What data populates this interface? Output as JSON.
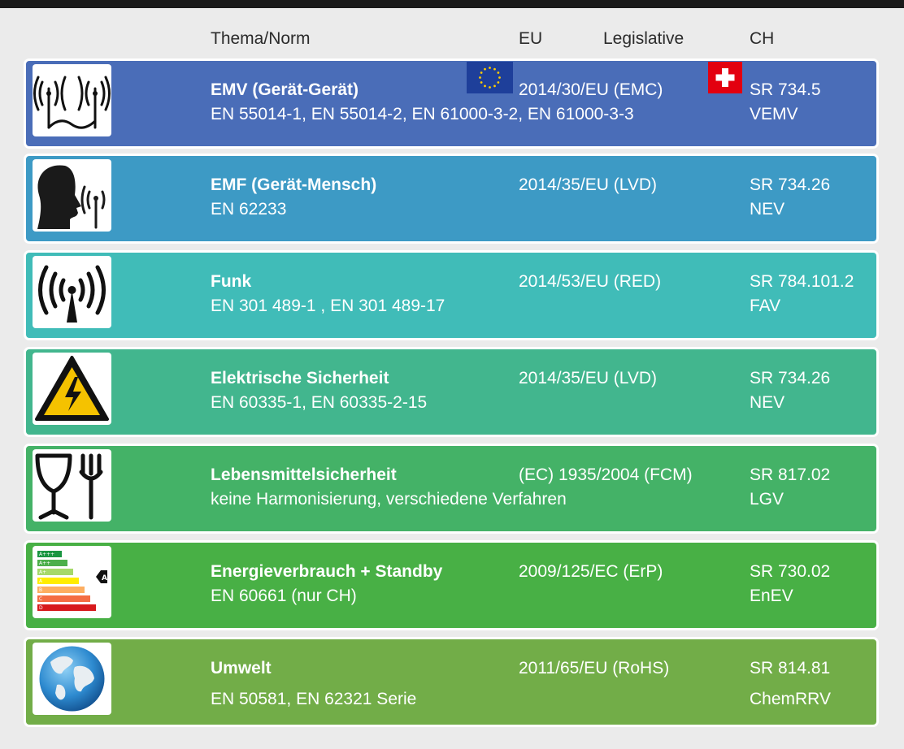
{
  "header": {
    "topic": "Thema/Norm",
    "eu": "EU",
    "legislative": "Legislative",
    "ch": "CH"
  },
  "flags": {
    "eu": "eu-flag-icon",
    "ch": "swiss-flag-icon"
  },
  "rows": [
    {
      "icon": "emc-device-icon",
      "color": "#4a6db8",
      "title": "EMV (Gerät-Gerät)",
      "norms": "EN 55014-1, EN 55014-2, EN 61000-3-2, EN 61000-3-3",
      "eu": "2014/30/EU (EMC)",
      "ch_code": "SR 734.5",
      "ch_abbr": "VEMV"
    },
    {
      "icon": "emf-person-icon",
      "color": "#3d9ac5",
      "title": "EMF (Gerät-Mensch)",
      "norms": "EN 62233",
      "eu": "2014/35/EU (LVD)",
      "ch_code": "SR 734.26",
      "ch_abbr": "NEV"
    },
    {
      "icon": "radio-antenna-icon",
      "color": "#40bcb8",
      "title": "Funk",
      "norms": "EN 301 489-1 , EN 301 489-17",
      "eu": "2014/53/EU (RED)",
      "ch_code": "SR 784.101.2",
      "ch_abbr": "FAV"
    },
    {
      "icon": "high-voltage-warning-icon",
      "color": "#42b68e",
      "title": "Elektrische Sicherheit",
      "norms": "EN 60335-1, EN 60335-2-15",
      "eu": "2014/35/EU (LVD)",
      "ch_code": "SR 734.26",
      "ch_abbr": "NEV"
    },
    {
      "icon": "food-safe-icon",
      "color": "#44b267",
      "title": "Lebensmittelsicherheit",
      "norms": "keine Harmonisierung, verschiedene Verfahren",
      "eu": "(EC) 1935/2004 (FCM)",
      "ch_code": "SR 817.02",
      "ch_abbr": "LGV"
    },
    {
      "icon": "energy-label-icon",
      "color": "#48b045",
      "title": "Energieverbrauch + Standby",
      "norms": "EN 60661 (nur CH)",
      "eu": "2009/125/EC (ErP)",
      "ch_code": "SR 730.02",
      "ch_abbr": "EnEV"
    },
    {
      "icon": "globe-icon",
      "color": "#72ad48",
      "title": "Umwelt",
      "norms": "EN 50581, EN 62321 Serie",
      "eu": "2011/65/EU (RoHS)",
      "ch_code": "SR 814.81",
      "ch_abbr": "ChemRRV"
    }
  ],
  "energy_label": {
    "classes": [
      "A+++",
      "A++",
      "A+",
      "A",
      "B",
      "C",
      "D"
    ],
    "marker": "A"
  }
}
